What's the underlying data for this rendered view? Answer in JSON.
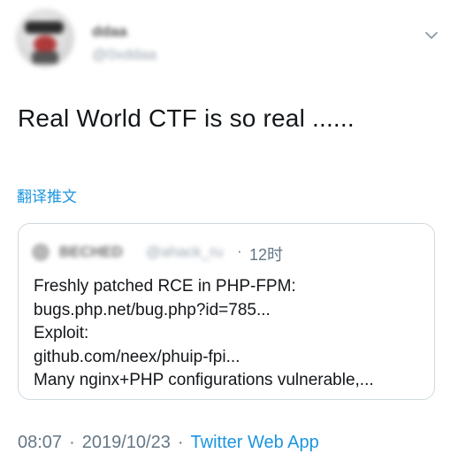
{
  "author": {
    "display_name": "ddaa",
    "handle": "@0xddaa"
  },
  "tweet": {
    "text": "Real World CTF is so real ......",
    "translate_label": "翻译推文"
  },
  "quoted_tweet": {
    "author_name": "BECHED",
    "author_handle": "@ahack_ru",
    "separator": "·",
    "time_ago": "12时",
    "lines": [
      "Freshly patched RCE in PHP-FPM:",
      "bugs.php.net/bug.php?id=785...",
      "Exploit:",
      "github.com/neex/phuip-fpi...",
      "Many nginx+PHP configurations vulnerable,..."
    ]
  },
  "footer": {
    "time": "08:07",
    "separator": "·",
    "date": "2019/10/23",
    "source": "Twitter Web App"
  },
  "colors": {
    "link": "#1b95e0",
    "muted": "#657786",
    "text": "#14171a",
    "border": "#cfd9de"
  },
  "icons": {
    "menu": "chevron-down-icon"
  }
}
